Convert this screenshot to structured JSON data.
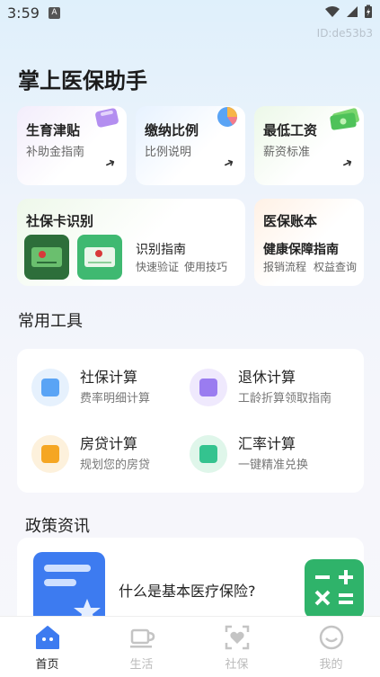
{
  "status_bar": {
    "time": "3:59",
    "notification_letter": "A"
  },
  "device_id": "ID:de53b3",
  "page_title": "掌上医保助手",
  "feature_cards": [
    {
      "title": "生育津贴",
      "subtitle": "补助金指南"
    },
    {
      "title": "缴纳比例",
      "subtitle": "比例说明"
    },
    {
      "title": "最低工资",
      "subtitle": "薪资标准"
    }
  ],
  "social_card": {
    "title": "社保卡识别",
    "guide_title": "识别指南",
    "guide_sub_1": "快速验证",
    "guide_sub_2": "使用技巧"
  },
  "medical_account": {
    "title": "医保账本",
    "guide_title": "健康保障指南",
    "guide_sub_1": "报销流程",
    "guide_sub_2": "权益查询"
  },
  "tools_section": {
    "title": "常用工具",
    "items": [
      {
        "name": "社保计算",
        "desc": "费率明细计算",
        "icon": "social-calc-icon",
        "color": "#5aa4f5"
      },
      {
        "name": "退休计算",
        "desc": "工龄折算领取指南",
        "icon": "retire-calc-icon",
        "color": "#9a7cf0"
      },
      {
        "name": "房贷计算",
        "desc": "规划您的房贷",
        "icon": "mortgage-calc-icon",
        "color": "#f5a623"
      },
      {
        "name": "汇率计算",
        "desc": "一键精准兑换",
        "icon": "exchange-calc-icon",
        "color": "#34c38f"
      }
    ]
  },
  "news_section": {
    "title": "政策资讯",
    "item_title": "什么是基本医疗保险?"
  },
  "tab_bar": [
    {
      "label": "首页",
      "icon": "home-icon",
      "active": true
    },
    {
      "label": "生活",
      "icon": "cup-icon",
      "active": false
    },
    {
      "label": "社保",
      "icon": "heart-frame-icon",
      "active": false
    },
    {
      "label": "我的",
      "icon": "smile-icon",
      "active": false
    }
  ],
  "colors": {
    "accent": "#3d7bf0",
    "green": "#2fb36a"
  }
}
